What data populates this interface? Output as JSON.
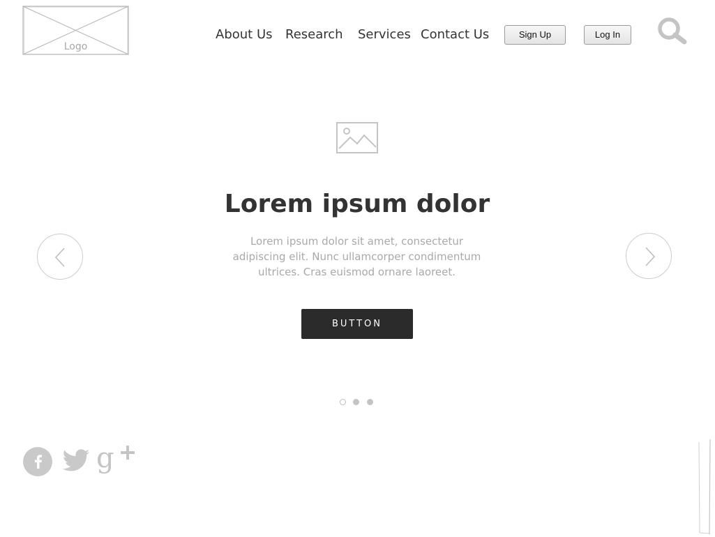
{
  "header": {
    "logo_label": "Logo",
    "nav": [
      "About Us",
      "Research",
      "Services",
      "Contact Us"
    ],
    "signup_label": "Sign Up",
    "login_label": "Log In",
    "search_icon": "search-icon"
  },
  "hero": {
    "image_icon": "image-placeholder-icon",
    "title": "Lorem ipsum dolor",
    "text": "Lorem ipsum dolor sit amet, consectetur adipiscing elit. Nunc ullamcorper condimentum ultrices. Cras euismod ornare laoreet.",
    "button_label": "BUTTON"
  },
  "carousel": {
    "prev_icon": "chevron-left-icon",
    "next_icon": "chevron-right-icon",
    "slide_count": 3,
    "active_slide": 1
  },
  "social": [
    "facebook-icon",
    "twitter-icon",
    "google-plus-icon"
  ],
  "colors": {
    "text_dark": "#333333",
    "text_muted": "#a9a9a9",
    "button_bg": "#2b2b2b",
    "wireframe_line": "#b5b5b5"
  }
}
